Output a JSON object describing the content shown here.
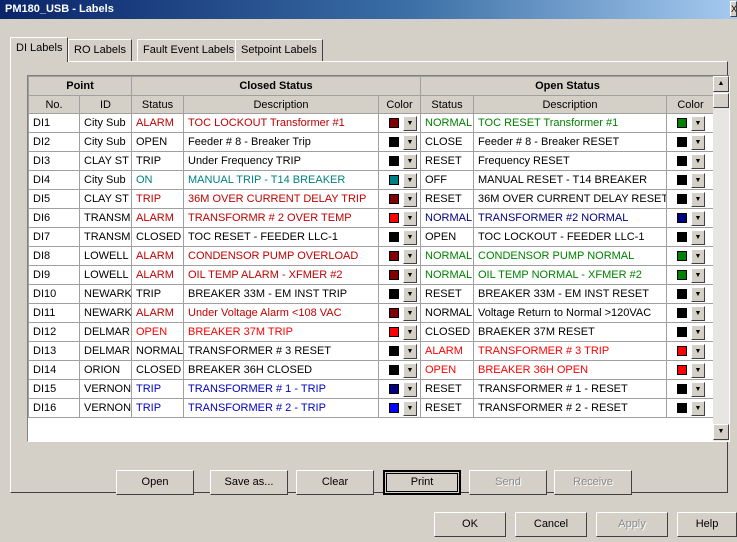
{
  "window": {
    "title": "PM180_USB - Labels",
    "close_glyph": "X"
  },
  "tabs": [
    "DI Labels",
    "RO Labels",
    "Fault Event Labels",
    "Setpoint Labels"
  ],
  "grid": {
    "group_headers": {
      "point": "Point",
      "closed": "Closed Status",
      "open": "Open Status"
    },
    "column_headers": [
      "No.",
      "ID",
      "Status",
      "Description",
      "Color",
      "Status",
      "Description",
      "Color"
    ],
    "rows": [
      {
        "no": "DI1",
        "id": "City Sub",
        "c_status": "ALARM",
        "c_desc": "TOC LOCKOUT Transformer #1",
        "c_color": "#800000",
        "c_text": "#c00000",
        "o_status": "NORMAL",
        "o_desc": "TOC RESET Transformer #1",
        "o_color": "#008000",
        "o_text": "#008000"
      },
      {
        "no": "DI2",
        "id": "City Sub",
        "c_status": "OPEN",
        "c_desc": "Feeder # 8 - Breaker Trip",
        "c_color": "#000000",
        "c_text": "#000000",
        "o_status": "CLOSE",
        "o_desc": "Feeder # 8 - Breaker RESET",
        "o_color": "#000000",
        "o_text": "#000000"
      },
      {
        "no": "DI3",
        "id": "CLAY ST",
        "c_status": "TRIP",
        "c_desc": "Under Frequency TRIP",
        "c_color": "#000000",
        "c_text": "#000000",
        "o_status": "RESET",
        "o_desc": "Frequency RESET",
        "o_color": "#000000",
        "o_text": "#000000"
      },
      {
        "no": "DI4",
        "id": "City Sub",
        "c_status": "ON",
        "c_desc": "MANUAL TRIP - T14 BREAKER",
        "c_color": "#008080",
        "c_text": "#008080",
        "o_status": "OFF",
        "o_desc": "MANUAL RESET - T14 BREAKER",
        "o_color": "#000000",
        "o_text": "#000000"
      },
      {
        "no": "DI5",
        "id": "CLAY ST",
        "c_status": "TRIP",
        "c_desc": "36M OVER CURRENT DELAY TRIP",
        "c_color": "#800000",
        "c_text": "#c00000",
        "o_status": "RESET",
        "o_desc": "36M OVER CURRENT DELAY RESET",
        "o_color": "#000000",
        "o_text": "#000000"
      },
      {
        "no": "DI6",
        "id": "TRANSM",
        "c_status": "ALARM",
        "c_desc": "TRANSFORMR # 2 OVER TEMP",
        "c_color": "#ff0000",
        "c_text": "#c00000",
        "o_status": "NORMAL",
        "o_desc": "TRANSFORMER #2 NORMAL",
        "o_color": "#000080",
        "o_text": "#000080"
      },
      {
        "no": "DI7",
        "id": "TRANSM",
        "c_status": "CLOSED",
        "c_desc": "TOC RESET - FEEDER LLC-1",
        "c_color": "#000000",
        "c_text": "#000000",
        "o_status": "OPEN",
        "o_desc": "TOC LOCKOUT - FEEDER LLC-1",
        "o_color": "#000000",
        "o_text": "#000000"
      },
      {
        "no": "DI8",
        "id": "LOWELL",
        "c_status": "ALARM",
        "c_desc": "CONDENSOR PUMP OVERLOAD",
        "c_color": "#800000",
        "c_text": "#c00000",
        "o_status": "NORMAL",
        "o_desc": "CONDENSOR PUMP NORMAL",
        "o_color": "#008000",
        "o_text": "#008000"
      },
      {
        "no": "DI9",
        "id": "LOWELL",
        "c_status": "ALARM",
        "c_desc": "OIL TEMP ALARM - XFMER #2",
        "c_color": "#800000",
        "c_text": "#c00000",
        "o_status": "NORMAL",
        "o_desc": "OIL TEMP NORMAL - XFMER #2",
        "o_color": "#008000",
        "o_text": "#008000"
      },
      {
        "no": "DI10",
        "id": "NEWARK",
        "c_status": "TRIP",
        "c_desc": "BREAKER 33M - EM INST TRIP",
        "c_color": "#000000",
        "c_text": "#000000",
        "o_status": "RESET",
        "o_desc": "BREAKER 33M - EM INST RESET",
        "o_color": "#000000",
        "o_text": "#000000"
      },
      {
        "no": "DI11",
        "id": "NEWARK",
        "c_status": "ALARM",
        "c_desc": "Under Voltage Alarm <108 VAC",
        "c_color": "#800000",
        "c_text": "#c00000",
        "o_status": "NORMAL",
        "o_desc": "Voltage Return to Normal >120VAC",
        "o_color": "#000000",
        "o_text": "#000000"
      },
      {
        "no": "DI12",
        "id": "DELMAR",
        "c_status": "OPEN",
        "c_desc": "BREAKER 37M TRIP",
        "c_color": "#ff0000",
        "c_text": "#ff0000",
        "o_status": "CLOSED",
        "o_desc": "BRAEKER 37M RESET",
        "o_color": "#000000",
        "o_text": "#000000"
      },
      {
        "no": "DI13",
        "id": "DELMAR",
        "c_status": "NORMAL",
        "c_desc": "TRANSFORMER # 3 RESET",
        "c_color": "#000000",
        "c_text": "#000000",
        "o_status": "ALARM",
        "o_desc": "TRANSFORMER # 3 TRIP",
        "o_color": "#ff0000",
        "o_text": "#ff0000"
      },
      {
        "no": "DI14",
        "id": "ORION",
        "c_status": "CLOSED",
        "c_desc": "BREAKER 36H CLOSED",
        "c_color": "#000000",
        "c_text": "#000000",
        "o_status": "OPEN",
        "o_desc": "BREAKER 36H OPEN",
        "o_color": "#ff0000",
        "o_text": "#ff0000"
      },
      {
        "no": "DI15",
        "id": "VERNON",
        "c_status": "TRIP",
        "c_desc": "TRANSFORMER # 1 - TRIP",
        "c_color": "#000080",
        "c_text": "#0000c0",
        "o_status": "RESET",
        "o_desc": "TRANSFORMER # 1 - RESET",
        "o_color": "#000000",
        "o_text": "#000000"
      },
      {
        "no": "DI16",
        "id": "VERNON",
        "c_status": "TRIP",
        "c_desc": "TRANSFORMER # 2 - TRIP",
        "c_color": "#0000ff",
        "c_text": "#0000c0",
        "o_status": "RESET",
        "o_desc": "TRANSFORMER # 2 - RESET",
        "o_color": "#000000",
        "o_text": "#000000"
      }
    ]
  },
  "action_buttons": [
    {
      "label": "Open",
      "enabled": true
    },
    {
      "label": "Save as...",
      "enabled": true
    },
    {
      "label": "Clear",
      "enabled": true
    },
    {
      "label": "Print",
      "enabled": true,
      "focused": true
    },
    {
      "label": "Send",
      "enabled": false
    },
    {
      "label": "Receive",
      "enabled": false
    }
  ],
  "dialog_buttons": [
    {
      "label": "OK",
      "enabled": true
    },
    {
      "label": "Cancel",
      "enabled": true
    },
    {
      "label": "Apply",
      "enabled": false
    },
    {
      "label": "Help",
      "enabled": true
    }
  ],
  "icons": {
    "dropdown": "triangle-down",
    "scroll_up": "triangle-up",
    "scroll_down": "triangle-down"
  }
}
